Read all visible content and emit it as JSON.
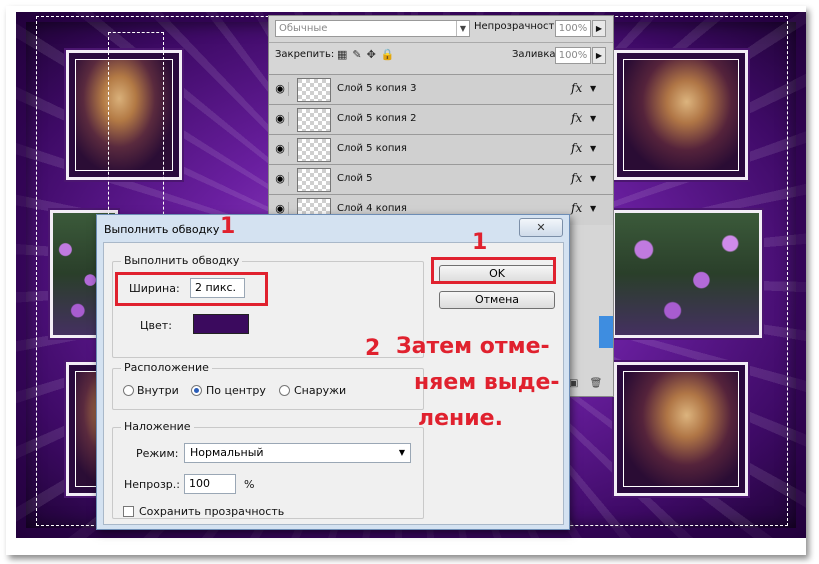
{
  "layers_panel": {
    "blend_mode": "Обычные",
    "opacity_label": "Непрозрачность:",
    "opacity_value": "100%",
    "lock_label": "Закрепить:",
    "fill_label": "Заливка:",
    "fill_value": "100%",
    "fx_label": "fx",
    "layers": [
      {
        "name": "Слой 5 копия 3"
      },
      {
        "name": "Слой 5 копия 2"
      },
      {
        "name": "Слой 5 копия"
      },
      {
        "name": "Слой 5"
      },
      {
        "name": "Слой 4 копия"
      }
    ]
  },
  "dialog": {
    "title": "Выполнить обводку",
    "close_label": "✕",
    "stroke_group": "Выполнить обводку",
    "width_label": "Ширина:",
    "width_value": "2 пикс.",
    "color_label": "Цвет:",
    "color_value": "#3b0a5e",
    "location_group": "Расположение",
    "location_options": [
      "Внутри",
      "По центру",
      "Снаружи"
    ],
    "location_selected": "По центру",
    "blending_group": "Наложение",
    "mode_label": "Режим:",
    "mode_value": "Нормальный",
    "opacity_label": "Непрозр.:",
    "opacity_value": "100",
    "opacity_unit": "%",
    "preserve_label": "Сохранить прозрачность",
    "ok_label": "OK",
    "cancel_label": "Отмена"
  },
  "annotations": {
    "step1_title": "1",
    "step1_ok": "1",
    "step2_number": "2",
    "step2_text_line1": "Затем отме-",
    "step2_text_line2": "няем выде-",
    "step2_text_line3": "ление."
  },
  "colors": {
    "accent_red": "#e0212e",
    "canvas_purple": "#6a1fa0",
    "stroke_color": "#3b0a5e"
  }
}
